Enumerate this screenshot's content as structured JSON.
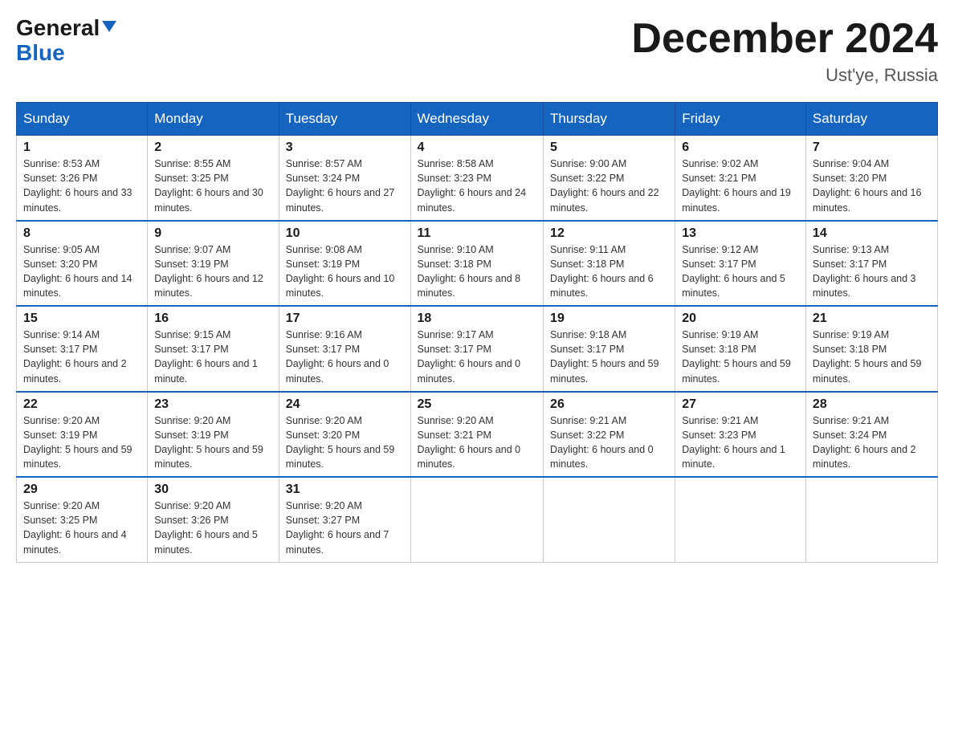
{
  "header": {
    "logo_general": "General",
    "logo_blue": "Blue",
    "month_title": "December 2024",
    "location": "Ust'ye, Russia"
  },
  "days_of_week": [
    "Sunday",
    "Monday",
    "Tuesday",
    "Wednesday",
    "Thursday",
    "Friday",
    "Saturday"
  ],
  "weeks": [
    [
      {
        "day": "1",
        "sunrise": "8:53 AM",
        "sunset": "3:26 PM",
        "daylight": "6 hours and 33 minutes."
      },
      {
        "day": "2",
        "sunrise": "8:55 AM",
        "sunset": "3:25 PM",
        "daylight": "6 hours and 30 minutes."
      },
      {
        "day": "3",
        "sunrise": "8:57 AM",
        "sunset": "3:24 PM",
        "daylight": "6 hours and 27 minutes."
      },
      {
        "day": "4",
        "sunrise": "8:58 AM",
        "sunset": "3:23 PM",
        "daylight": "6 hours and 24 minutes."
      },
      {
        "day": "5",
        "sunrise": "9:00 AM",
        "sunset": "3:22 PM",
        "daylight": "6 hours and 22 minutes."
      },
      {
        "day": "6",
        "sunrise": "9:02 AM",
        "sunset": "3:21 PM",
        "daylight": "6 hours and 19 minutes."
      },
      {
        "day": "7",
        "sunrise": "9:04 AM",
        "sunset": "3:20 PM",
        "daylight": "6 hours and 16 minutes."
      }
    ],
    [
      {
        "day": "8",
        "sunrise": "9:05 AM",
        "sunset": "3:20 PM",
        "daylight": "6 hours and 14 minutes."
      },
      {
        "day": "9",
        "sunrise": "9:07 AM",
        "sunset": "3:19 PM",
        "daylight": "6 hours and 12 minutes."
      },
      {
        "day": "10",
        "sunrise": "9:08 AM",
        "sunset": "3:19 PM",
        "daylight": "6 hours and 10 minutes."
      },
      {
        "day": "11",
        "sunrise": "9:10 AM",
        "sunset": "3:18 PM",
        "daylight": "6 hours and 8 minutes."
      },
      {
        "day": "12",
        "sunrise": "9:11 AM",
        "sunset": "3:18 PM",
        "daylight": "6 hours and 6 minutes."
      },
      {
        "day": "13",
        "sunrise": "9:12 AM",
        "sunset": "3:17 PM",
        "daylight": "6 hours and 5 minutes."
      },
      {
        "day": "14",
        "sunrise": "9:13 AM",
        "sunset": "3:17 PM",
        "daylight": "6 hours and 3 minutes."
      }
    ],
    [
      {
        "day": "15",
        "sunrise": "9:14 AM",
        "sunset": "3:17 PM",
        "daylight": "6 hours and 2 minutes."
      },
      {
        "day": "16",
        "sunrise": "9:15 AM",
        "sunset": "3:17 PM",
        "daylight": "6 hours and 1 minute."
      },
      {
        "day": "17",
        "sunrise": "9:16 AM",
        "sunset": "3:17 PM",
        "daylight": "6 hours and 0 minutes."
      },
      {
        "day": "18",
        "sunrise": "9:17 AM",
        "sunset": "3:17 PM",
        "daylight": "6 hours and 0 minutes."
      },
      {
        "day": "19",
        "sunrise": "9:18 AM",
        "sunset": "3:17 PM",
        "daylight": "5 hours and 59 minutes."
      },
      {
        "day": "20",
        "sunrise": "9:19 AM",
        "sunset": "3:18 PM",
        "daylight": "5 hours and 59 minutes."
      },
      {
        "day": "21",
        "sunrise": "9:19 AM",
        "sunset": "3:18 PM",
        "daylight": "5 hours and 59 minutes."
      }
    ],
    [
      {
        "day": "22",
        "sunrise": "9:20 AM",
        "sunset": "3:19 PM",
        "daylight": "5 hours and 59 minutes."
      },
      {
        "day": "23",
        "sunrise": "9:20 AM",
        "sunset": "3:19 PM",
        "daylight": "5 hours and 59 minutes."
      },
      {
        "day": "24",
        "sunrise": "9:20 AM",
        "sunset": "3:20 PM",
        "daylight": "5 hours and 59 minutes."
      },
      {
        "day": "25",
        "sunrise": "9:20 AM",
        "sunset": "3:21 PM",
        "daylight": "6 hours and 0 minutes."
      },
      {
        "day": "26",
        "sunrise": "9:21 AM",
        "sunset": "3:22 PM",
        "daylight": "6 hours and 0 minutes."
      },
      {
        "day": "27",
        "sunrise": "9:21 AM",
        "sunset": "3:23 PM",
        "daylight": "6 hours and 1 minute."
      },
      {
        "day": "28",
        "sunrise": "9:21 AM",
        "sunset": "3:24 PM",
        "daylight": "6 hours and 2 minutes."
      }
    ],
    [
      {
        "day": "29",
        "sunrise": "9:20 AM",
        "sunset": "3:25 PM",
        "daylight": "6 hours and 4 minutes."
      },
      {
        "day": "30",
        "sunrise": "9:20 AM",
        "sunset": "3:26 PM",
        "daylight": "6 hours and 5 minutes."
      },
      {
        "day": "31",
        "sunrise": "9:20 AM",
        "sunset": "3:27 PM",
        "daylight": "6 hours and 7 minutes."
      },
      null,
      null,
      null,
      null
    ]
  ]
}
